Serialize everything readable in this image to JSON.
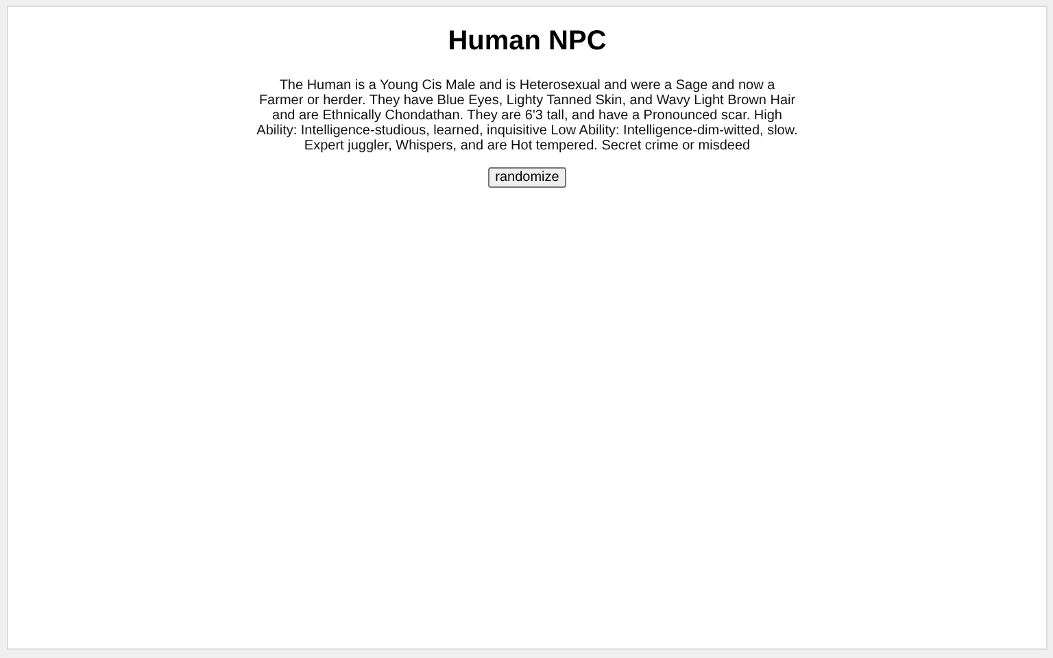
{
  "title": "Human NPC",
  "description": "The Human is a Young Cis Male and is Heterosexual and were a Sage and now a Farmer or herder. They have Blue Eyes, Lighty Tanned Skin, and Wavy Light Brown Hair and are Ethnically Chondathan. They are 6'3 tall, and have a Pronounced scar. High Ability: Intelligence-studious, learned, inquisitive Low Ability: Intelligence-dim-witted, slow. Expert juggler, Whispers, and are Hot tempered. Secret crime or misdeed",
  "button": "randomize"
}
